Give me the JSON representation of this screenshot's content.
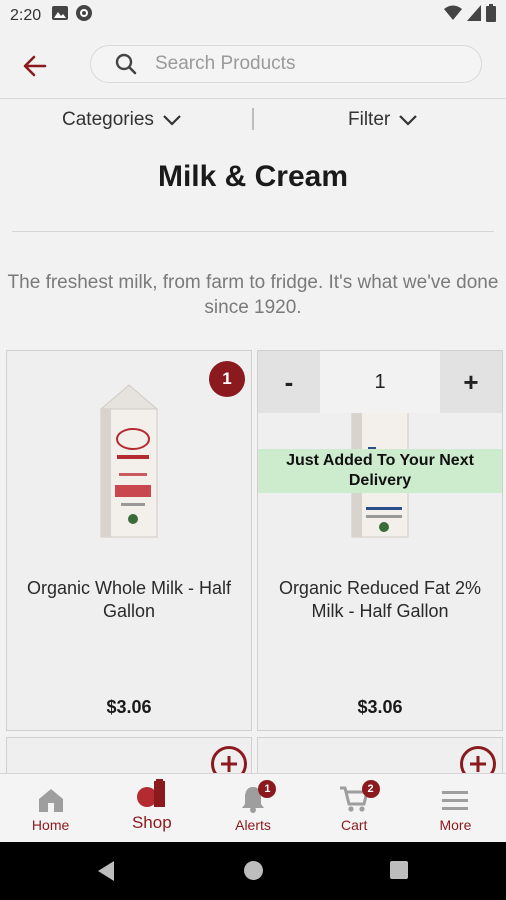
{
  "status_bar": {
    "time": "2:20"
  },
  "search": {
    "placeholder": "Search Products"
  },
  "filters": {
    "categories_label": "Categories",
    "filter_label": "Filter"
  },
  "page": {
    "title": "Milk & Cream",
    "tagline": "The freshest milk, from farm to fridge. It's what we've done since 1920."
  },
  "products": [
    {
      "name": "Organic Whole Milk - Half Gallon",
      "price": "$3.06",
      "cart_qty": "1"
    },
    {
      "name": "Organic Reduced Fat 2% Milk - Half Gallon",
      "price": "$3.06",
      "stepper_minus": "-",
      "stepper_value": "1",
      "stepper_plus": "+",
      "added_message": "Just Added To Your Next Delivery"
    }
  ],
  "bottom_nav": {
    "items": [
      {
        "label": "Home"
      },
      {
        "label": "Shop"
      },
      {
        "label": "Alerts",
        "badge": "1"
      },
      {
        "label": "Cart",
        "badge": "2"
      },
      {
        "label": "More"
      }
    ]
  },
  "colors": {
    "brand": "#8b1a1f",
    "added_banner": "#cdeccd"
  }
}
